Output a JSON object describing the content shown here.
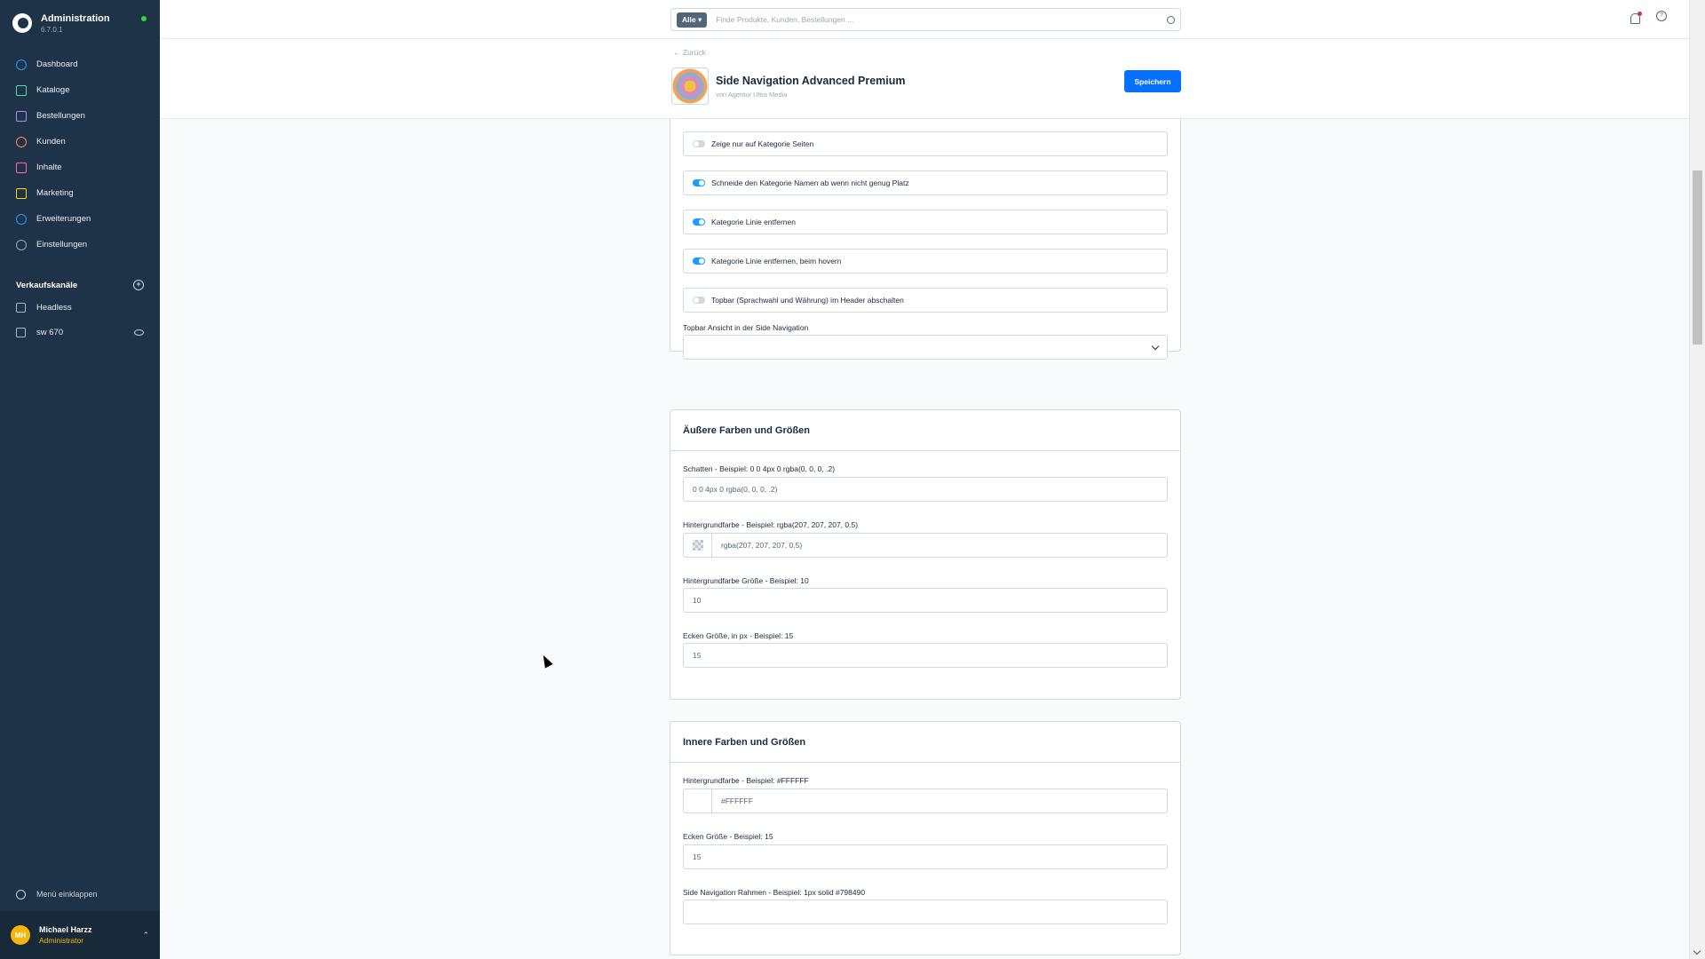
{
  "sidebar": {
    "brand_title": "Administration",
    "brand_version": "6.7.0.1",
    "items": [
      {
        "label": "Dashboard",
        "icon": "gauge-icon",
        "color": "#189eff"
      },
      {
        "label": "Kataloge",
        "icon": "catalog-icon",
        "color": "#57d9a3"
      },
      {
        "label": "Bestellungen",
        "icon": "shopping-bag-icon",
        "color": "#a092f0"
      },
      {
        "label": "Kunden",
        "icon": "user-icon",
        "color": "#f88962"
      },
      {
        "label": "Inhalte",
        "icon": "content-icon",
        "color": "#ff68b4"
      },
      {
        "label": "Marketing",
        "icon": "megaphone-icon",
        "color": "#ffd700"
      },
      {
        "label": "Erweiterungen",
        "icon": "plug-icon",
        "color": "#189eff"
      },
      {
        "label": "Einstellungen",
        "icon": "gear-icon",
        "color": "#9aa8b5"
      }
    ],
    "sales_channels_title": "Verkaufskanäle",
    "sales_channels": [
      {
        "label": "Headless"
      },
      {
        "label": "sw 670"
      }
    ],
    "collapse_label": "Menü einklappen",
    "user": {
      "initials": "MH",
      "name": "Michael Harzz",
      "role": "Administrator"
    }
  },
  "search": {
    "filter_label": "Alle",
    "placeholder": "Finde Produkte, Kunden, Bestellungen ..."
  },
  "header": {
    "back_label": "← Zurück",
    "title": "Side Navigation Advanced Premium",
    "vendor": "von Agentur Ultra Media",
    "save_label": "Speichern"
  },
  "general": {
    "toggles": [
      {
        "label": "Zeige nur auf Kategorie Seiten",
        "on": false
      },
      {
        "label": "Schneide den Kategorie Namen ab wenn nicht genug Platz",
        "on": true
      },
      {
        "label": "Kategorie Linie entfernen",
        "on": true
      },
      {
        "label": "Kategorie Linie entfernen, beim hovern",
        "on": true
      },
      {
        "label": "Topbar (Sprachwahl und Währung) im Header abschalten",
        "on": false
      }
    ],
    "topbar_view_label": "Topbar Ansicht in der Side Navigation",
    "topbar_view_value": ""
  },
  "outer": {
    "title": "Äußere Farben und Größen",
    "shadow_label": "Schatten - Beispiel: 0 0 4px 0 rgba(0, 0, 0, .2)",
    "shadow_value": "0 0 4px 0 rgba(0, 0, 0, .2)",
    "bg_label": "Hintergrundfarbe - Beispiel: rgba(207, 207, 207, 0.5)",
    "bg_value": "rgba(207, 207, 207, 0.5)",
    "bg_size_label": "Hintergrundfarbe Größe - Beispiel: 10",
    "bg_size_value": "10",
    "corner_label": "Ecken Größe, in px - Beispiel: 15",
    "corner_value": "15"
  },
  "inner": {
    "title": "Innere Farben und Größen",
    "bg_label": "Hintergrundfarbe - Beispiel: #FFFFFF",
    "bg_value": "#FFFFFF",
    "corner_label": "Ecken Größe - Beispiel: 15",
    "corner_value": "15",
    "border_label": "Side Navigation Rahmen - Beispiel: 1px solid #798490",
    "border_value": ""
  }
}
